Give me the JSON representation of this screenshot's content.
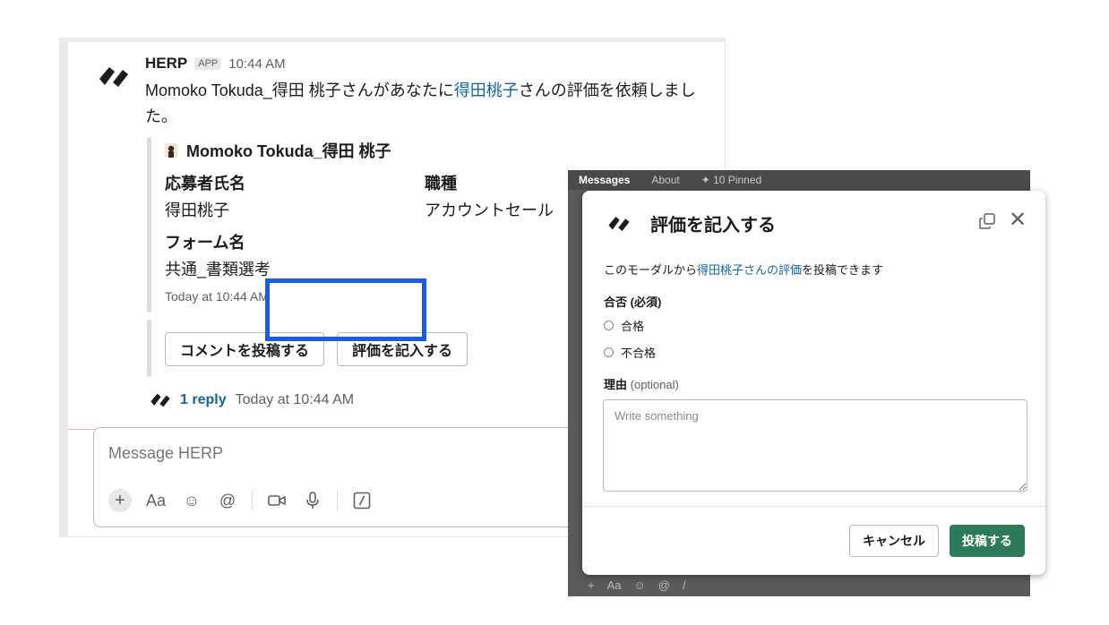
{
  "message": {
    "sender": "HERP",
    "badge": "APP",
    "time": "10:44 AM",
    "text_part1": "Momoko Tokuda_得田 桃子さんがあなたに",
    "text_link": "得田桃子",
    "text_part2": "さんの評価を依頼しました。"
  },
  "attachment": {
    "author": "Momoko Tokuda_得田 桃子",
    "fields": [
      {
        "title": "応募者氏名",
        "value": "得田桃子"
      },
      {
        "title": "職種",
        "value": "アカウントセール"
      },
      {
        "title": "フォーム名",
        "value": "共通_書類選考"
      }
    ],
    "time": "Today at 10:44 AM",
    "buttons": {
      "comment": "コメントを投稿する",
      "evaluate": "評価を記入する"
    }
  },
  "thread": {
    "reply": "1 reply",
    "time": "Today at 10:44 AM"
  },
  "composer": {
    "placeholder": "Message HERP",
    "tools": {
      "plus": "+",
      "format": "Aa",
      "emoji": "☺",
      "mention": "@",
      "shortcut": "/"
    }
  },
  "dark_panel": {
    "tabs": [
      "Messages",
      "About",
      "10 Pinned"
    ],
    "bottom_tools": [
      "+",
      "Aa",
      "☺",
      "@",
      "/"
    ]
  },
  "modal": {
    "title": "評価を記入する",
    "desc_part1": "このモーダルから",
    "desc_link": "得田桃子さんの評価",
    "desc_part2": "を投稿できます",
    "pass_label": "合否 (必須)",
    "options": [
      "合格",
      "不合格"
    ],
    "reason_label": "理由",
    "reason_optional": "(optional)",
    "placeholder": "Write something",
    "cancel": "キャンセル",
    "submit": "投稿する"
  },
  "colors": {
    "link": "#1264a3",
    "submit": "#2d7a5a",
    "highlight": "#1a5ce3"
  }
}
